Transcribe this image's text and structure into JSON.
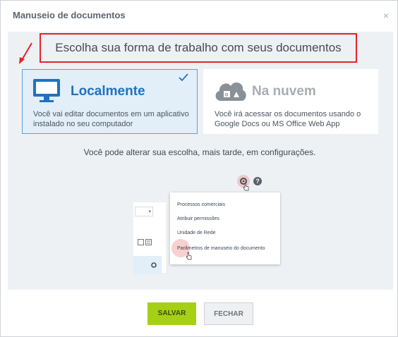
{
  "dialog": {
    "title": "Manuseio de documentos",
    "close_label": "×"
  },
  "heading": "Escolha sua forma de trabalho com seus documentos",
  "options": {
    "local": {
      "title": "Localmente",
      "description": "Você vai editar documentos em um aplicativo instalado no seu computador",
      "selected": true,
      "icon": "monitor-icon"
    },
    "cloud": {
      "title": "Na nuvem",
      "description": "Você irá acessar os documentos usando o Google Docs ou MS Office Web App",
      "selected": false,
      "icon": "cloud-icon"
    }
  },
  "hint": "Você pode alterar sua escolha, mais tarde, em configurações.",
  "preview_menu": {
    "items": [
      "Processos comerciais",
      "Atribuir permissões",
      "Unidade de Rede",
      "Parâmetros de manuseio do documento"
    ]
  },
  "buttons": {
    "save": "SALVAR",
    "close": "FECHAR"
  },
  "colors": {
    "accent_blue": "#1e73be",
    "highlight_red": "#e3222a",
    "save_green": "#a5d015"
  }
}
